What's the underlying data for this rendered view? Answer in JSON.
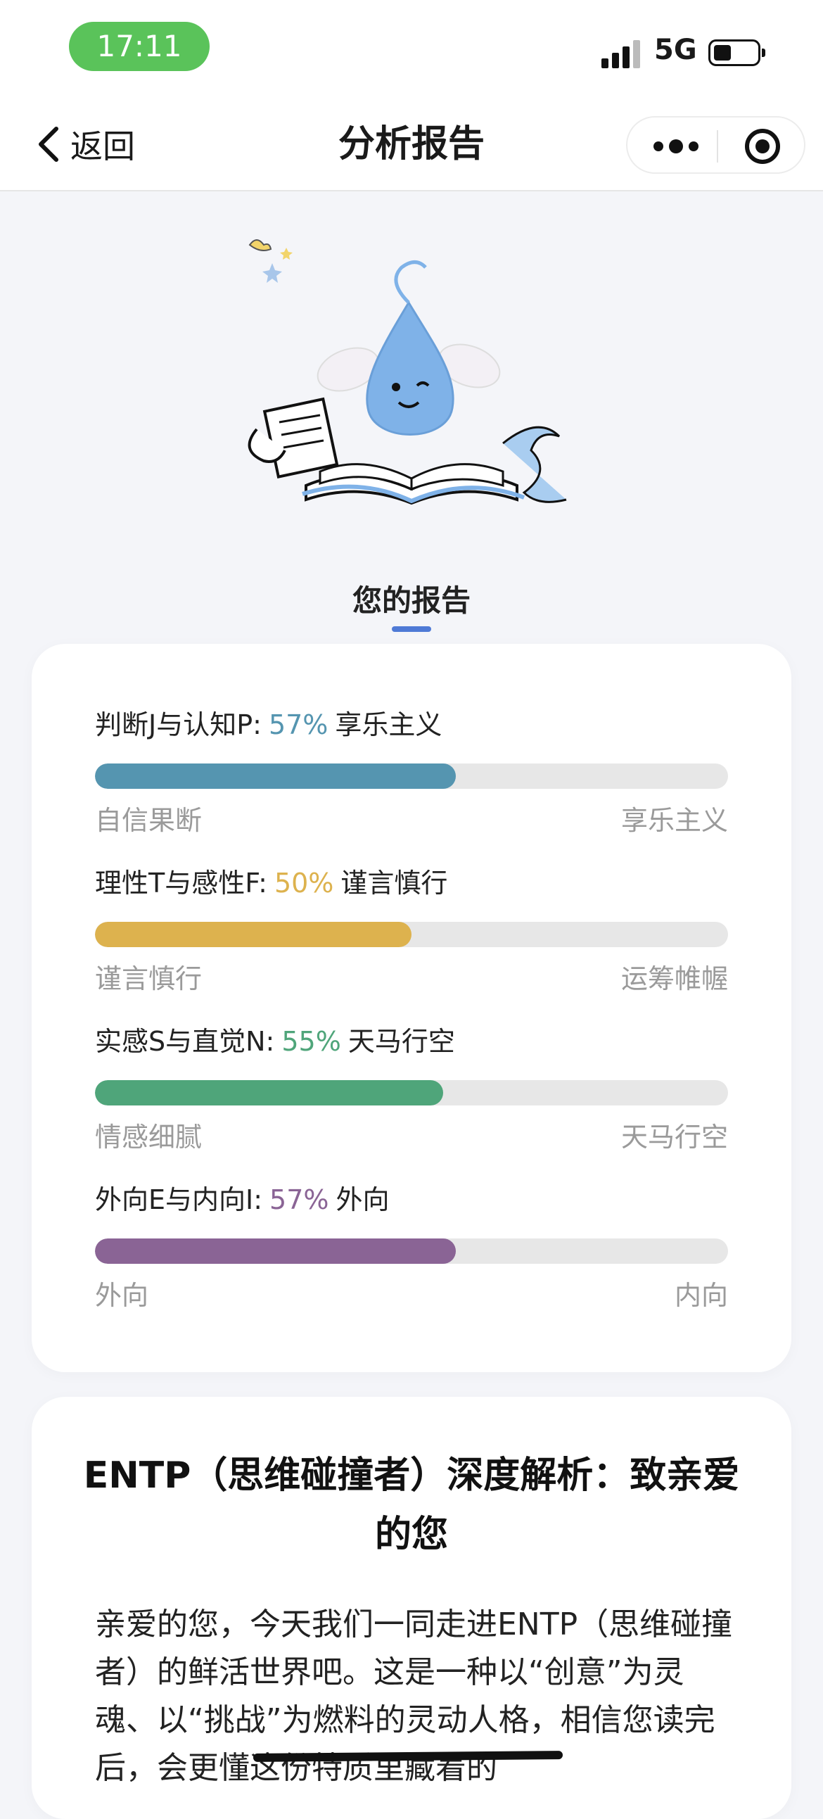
{
  "status_bar": {
    "time": "17:11",
    "network": "5G"
  },
  "nav": {
    "back_label": "返回",
    "title": "分析报告"
  },
  "report_tab": "您的报告",
  "metrics": [
    {
      "prefix": "判断J与认知P:",
      "percent": "57%",
      "result": "享乐主义",
      "left_label": "自信果断",
      "right_label": "享乐主义",
      "value": 0.57,
      "color": "#5595b0"
    },
    {
      "prefix": "理性T与感性F:",
      "percent": "50%",
      "result": "谨言慎行",
      "left_label": "谨言慎行",
      "right_label": "运筹帷幄",
      "value": 0.5,
      "color": "#ddb24e"
    },
    {
      "prefix": "实感S与直觉N:",
      "percent": "55%",
      "result": "天马行空",
      "left_label": "情感细腻",
      "right_label": "天马行空",
      "value": 0.55,
      "color": "#4fa57a"
    },
    {
      "prefix": "外向E与内向I:",
      "percent": "57%",
      "result": "外向",
      "left_label": "外向",
      "right_label": "内向",
      "value": 0.57,
      "color": "#8a6495"
    }
  ],
  "analysis": {
    "title": "ENTP（思维碰撞者）深度解析：致亲爱的您",
    "body": "亲爱的您，今天我们一同走进ENTP（思维碰撞者）的鲜活世界吧。这是一种以“创意”为灵魂、以“挑战”为燃料的灵动人格，相信您读完后，会更懂这份特质里藏着的"
  }
}
